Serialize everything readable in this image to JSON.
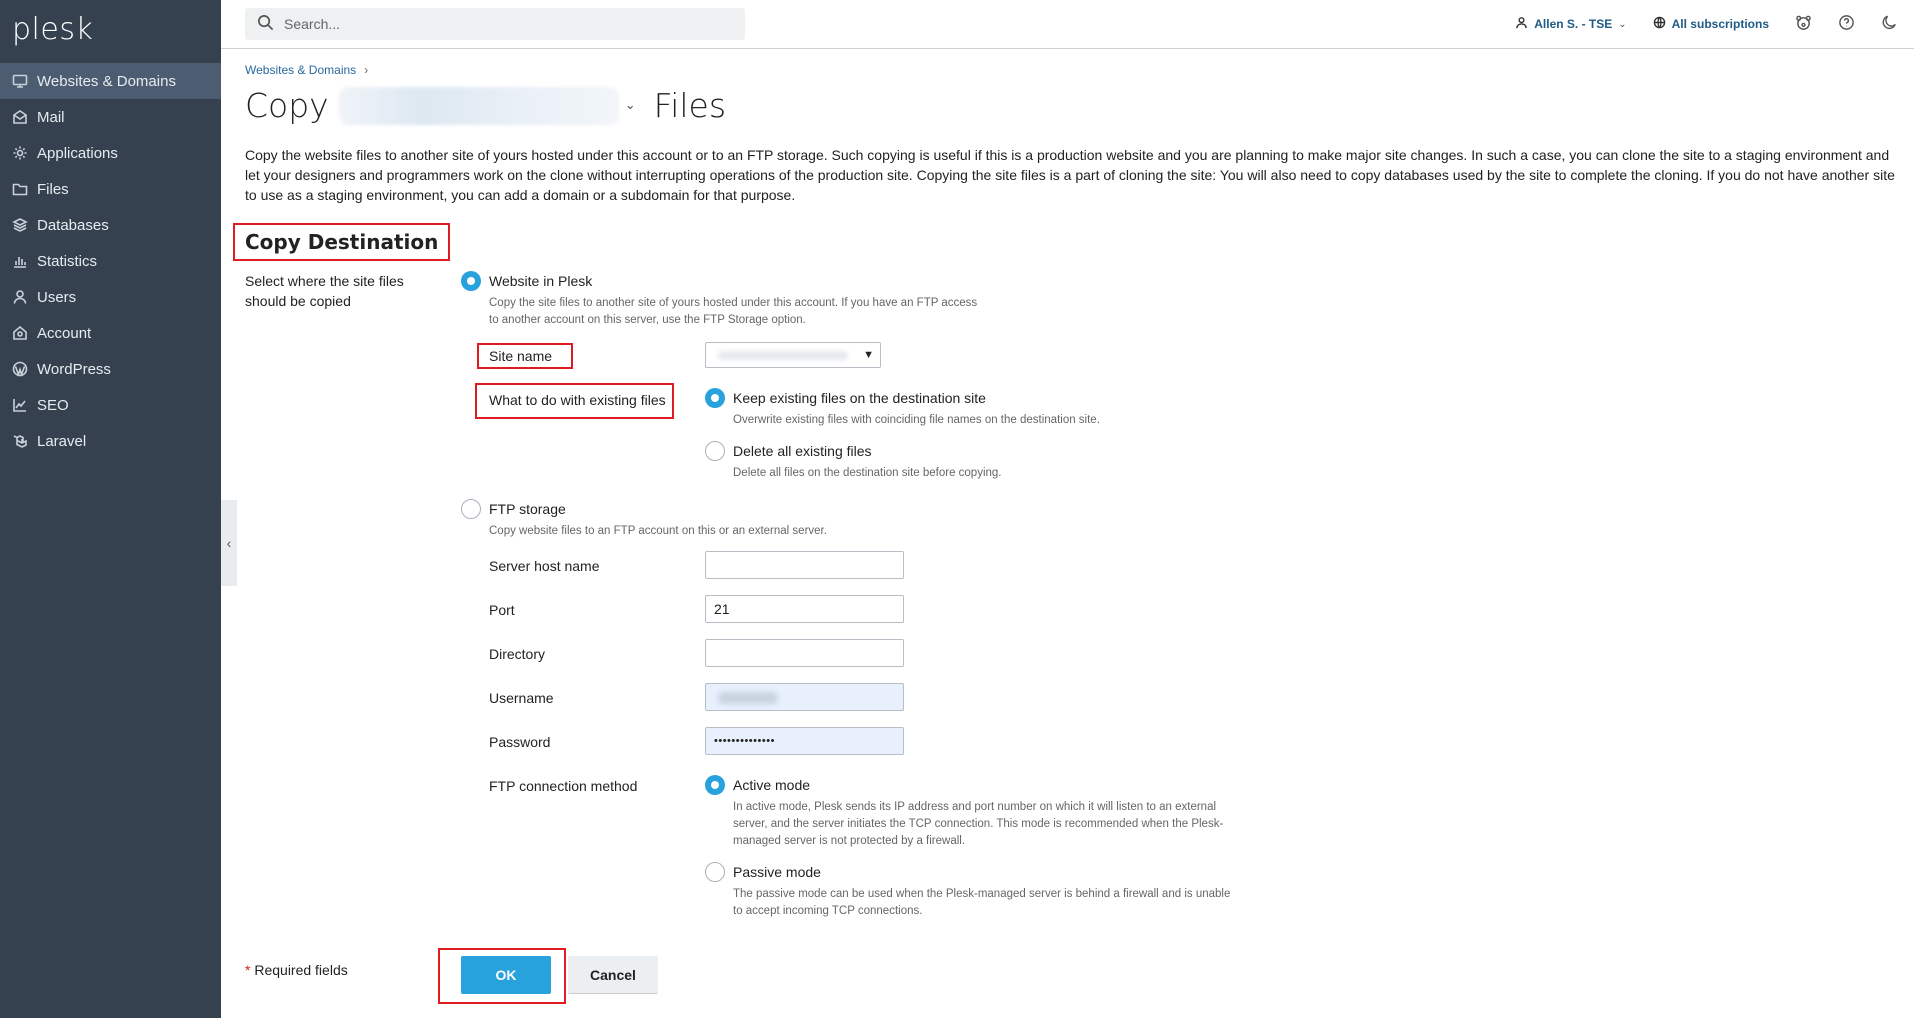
{
  "app": {
    "logo": "plesk"
  },
  "sidebar": {
    "items": [
      {
        "label": "Websites & Domains",
        "icon": "monitor-icon"
      },
      {
        "label": "Mail",
        "icon": "mail-icon"
      },
      {
        "label": "Applications",
        "icon": "gear-icon"
      },
      {
        "label": "Files",
        "icon": "folder-icon"
      },
      {
        "label": "Databases",
        "icon": "layers-icon"
      },
      {
        "label": "Statistics",
        "icon": "bar-chart-icon"
      },
      {
        "label": "Users",
        "icon": "user-icon"
      },
      {
        "label": "Account",
        "icon": "account-icon"
      },
      {
        "label": "WordPress",
        "icon": "wordpress-icon"
      },
      {
        "label": "SEO",
        "icon": "seo-icon"
      },
      {
        "label": "Laravel",
        "icon": "laravel-icon"
      }
    ],
    "active_index": 0
  },
  "topbar": {
    "search_placeholder": "Search...",
    "user": "Allen S. - TSE",
    "subscriptions": "All subscriptions"
  },
  "breadcrumb": {
    "item": "Websites & Domains",
    "separator": "›"
  },
  "title": {
    "prefix": "Copy",
    "suffix": "Files",
    "chevron": "⌄"
  },
  "intro": "Copy the website files to another site of yours hosted under this account or to an FTP storage. Such copying is useful if this is a production website and you are planning to make major site changes. In such a case, you can clone the site to a staging environment and let your designers and programmers work on the clone without interrupting operations of the production site. Copying the site files is a part of cloning the site: You will also need to copy databases used by the site to complete the cloning. If you do not have another site to use as a staging environment, you can add a domain or a subdomain for that purpose.",
  "section": {
    "title": "Copy Destination",
    "field_label": "Select where the site files should be copied"
  },
  "website_option": {
    "label": "Website in Plesk",
    "hint": "Copy the site files to another site of yours hosted under this account. If you have an FTP access to another account on this server, use the FTP Storage option.",
    "checked": true,
    "site_name_label": "Site name",
    "existing_label": "What to do with existing files",
    "keep": {
      "label": "Keep existing files on the destination site",
      "hint": "Overwrite existing files with coinciding file names on the destination site.",
      "checked": true
    },
    "delete": {
      "label": "Delete all existing files",
      "hint": "Delete all files on the destination site before copying.",
      "checked": false
    }
  },
  "ftp_option": {
    "label": "FTP storage",
    "hint": "Copy website files to an FTP account on this or an external server.",
    "checked": false,
    "host_label": "Server host name",
    "host_value": "",
    "port_label": "Port",
    "port_value": "21",
    "directory_label": "Directory",
    "directory_value": "",
    "username_label": "Username",
    "password_label": "Password",
    "password_value": "••••••••••••••",
    "method_label": "FTP connection method",
    "active": {
      "label": "Active mode",
      "hint": "In active mode, Plesk sends its IP address and port number on which it will listen to an external server, and the server initiates the TCP connection. This mode is recommended when the Plesk-managed server is not protected by a firewall.",
      "checked": true
    },
    "passive": {
      "label": "Passive mode",
      "hint": "The passive mode can be used when the Plesk-managed server is behind a firewall and is unable to accept incoming TCP connections.",
      "checked": false
    }
  },
  "footer": {
    "required_star": "*",
    "required_text": "Required fields",
    "ok": "OK",
    "cancel": "Cancel"
  },
  "colors": {
    "sidebar_bg": "#36414f",
    "accent": "#28a2dd",
    "highlight_border": "#e01b22",
    "link": "#28689d"
  }
}
